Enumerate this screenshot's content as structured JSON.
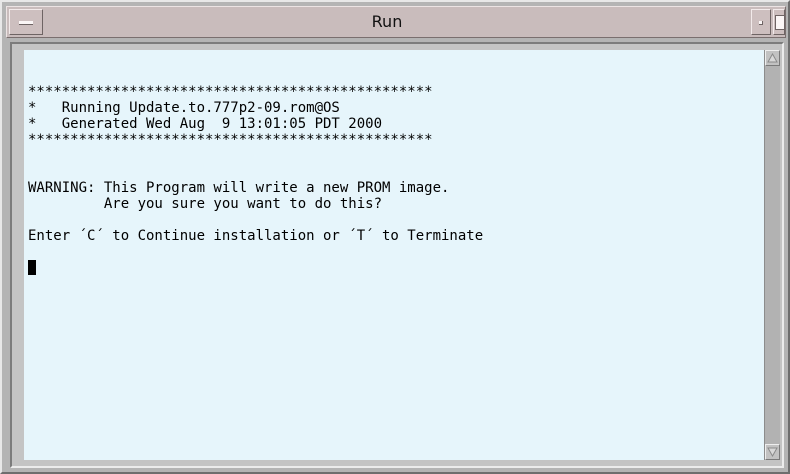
{
  "window": {
    "title": "Run",
    "icons": {
      "menu": "window-menu-icon",
      "minimize": "minimize-icon",
      "maximize": "maximize-icon",
      "scroll_up": "arrow-up-icon",
      "scroll_down": "arrow-down-icon"
    }
  },
  "terminal": {
    "lines": [
      "************************************************",
      "*   Running Update.to.777p2-09.rom@OS",
      "*   Generated Wed Aug  9 13:01:05 PDT 2000",
      "************************************************",
      "",
      "",
      "WARNING: This Program will write a new PROM image.",
      "         Are you sure you want to do this?",
      "",
      "Enter ´C´ to Continue installation or ´T´ to Terminate"
    ]
  },
  "colors": {
    "titlebar": "#c9bcbc",
    "terminal_bg": "#e6f5fb",
    "frame": "#b4b4b4",
    "text": "#000000"
  }
}
